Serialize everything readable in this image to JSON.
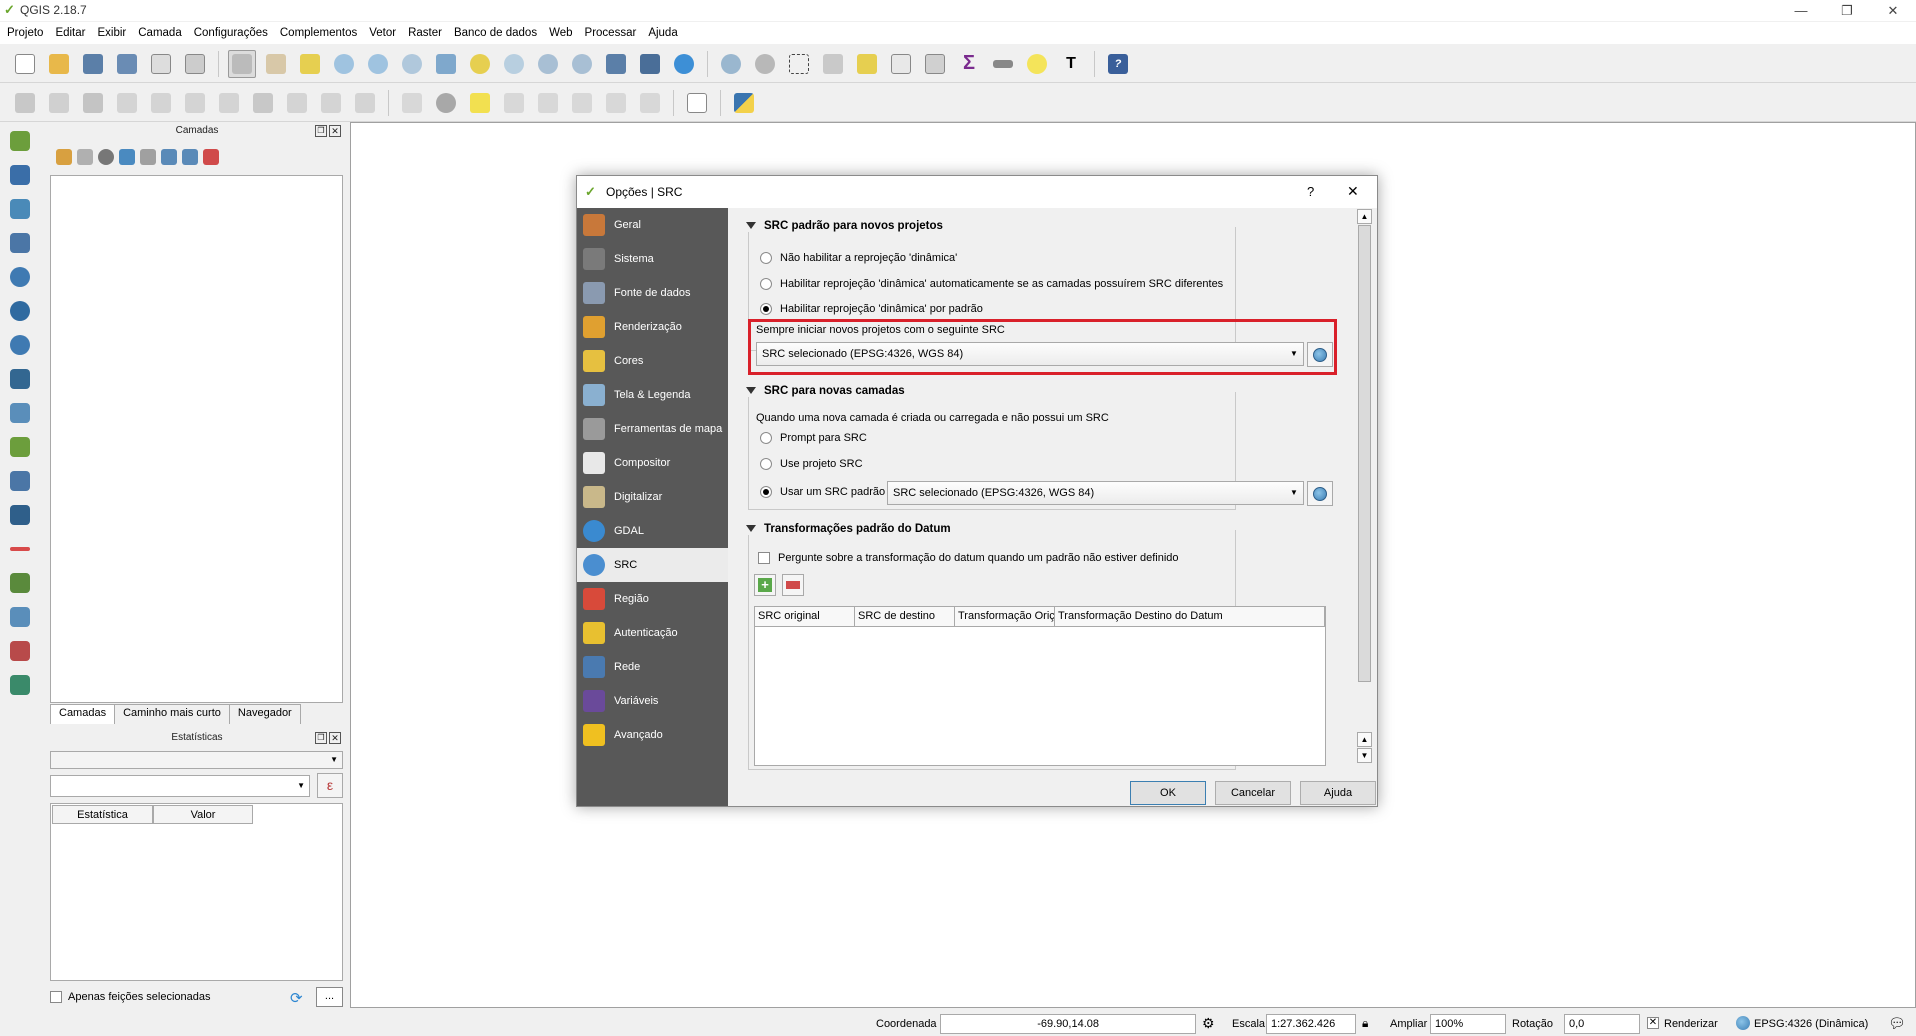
{
  "app": {
    "title": "QGIS 2.18.7"
  },
  "menu": [
    "Projeto",
    "Editar",
    "Exibir",
    "Camada",
    "Configurações",
    "Complementos",
    "Vetor",
    "Raster",
    "Banco de dados",
    "Web",
    "Processar",
    "Ajuda"
  ],
  "layers_panel": {
    "title": "Camadas",
    "tabs": [
      "Camadas",
      "Caminho mais curto",
      "Navegador"
    ]
  },
  "stats_panel": {
    "title": "Estatísticas",
    "expr_btn": "ε",
    "columns": [
      "Estatística",
      "Valor"
    ],
    "only_selected": "Apenas feições selecionadas",
    "more_btn": "..."
  },
  "status": {
    "coord_label": "Coordenada",
    "coord_value": "-69.90,14.08",
    "scale_label": "Escala",
    "scale_value": "1:27.362.426",
    "magnify_label": "Ampliar",
    "magnify_value": "100%",
    "rotation_label": "Rotação",
    "rotation_value": "0,0",
    "render_label": "Renderizar",
    "crs_label": "EPSG:4326 (Dinâmica)"
  },
  "dialog": {
    "title": "Opções | SRC",
    "help": "?",
    "close": "✕",
    "nav": [
      "Geral",
      "Sistema",
      "Fonte de dados",
      "Renderização",
      "Cores",
      "Tela & Legenda",
      "Ferramentas de mapa",
      "Compositor",
      "Digitalizar",
      "GDAL",
      "SRC",
      "Região",
      "Autenticação",
      "Rede",
      "Variáveis",
      "Avançado"
    ],
    "nav_active_index": 10,
    "group1": {
      "title": "SRC padrão para novos projetos",
      "opt1": "Não habilitar a reprojeção 'dinâmica'",
      "opt2": "Habilitar reprojeção 'dinâmica' automaticamente se as camadas possuírem SRC diferentes",
      "opt3": "Habilitar reprojeção 'dinâmica' por padrão",
      "always_label": "Sempre iniciar novos projetos com o seguinte SRC",
      "crs_value": "SRC selecionado (EPSG:4326, WGS 84)"
    },
    "group2": {
      "title": "SRC para novas camadas",
      "desc": "Quando uma nova camada é criada ou carregada e não possui um SRC",
      "opt1": "Prompt para SRC",
      "opt2": "Use projeto SRC",
      "opt3": "Usar um SRC padrão",
      "crs_value": "SRC selecionado (EPSG:4326, WGS 84)"
    },
    "group3": {
      "title": "Transformações padrão do Datum",
      "ask": "Pergunte sobre a transformação do datum quando um padrão não estiver definido",
      "columns": [
        "SRC original",
        "SRC de destino",
        "Transformação Oriç",
        "Transformação Destino do Datum"
      ]
    },
    "buttons": {
      "ok": "OK",
      "cancel": "Cancelar",
      "help": "Ajuda"
    },
    "highlight_color": "#d9202a"
  }
}
